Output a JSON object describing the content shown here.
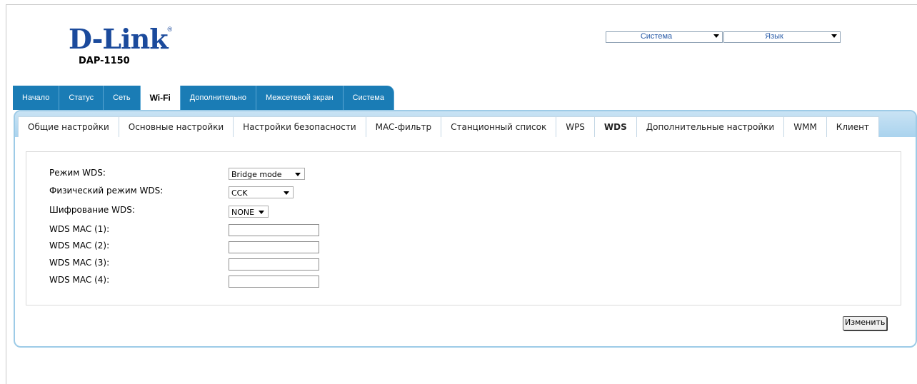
{
  "header": {
    "logo_text": "D-Link",
    "logo_reg": "®",
    "model": "DAP-1150",
    "system_select": "Система",
    "language_select": "Язык"
  },
  "main_tabs": [
    {
      "label": "Начало"
    },
    {
      "label": "Статус"
    },
    {
      "label": "Сеть"
    },
    {
      "label": "Wi-Fi",
      "active": true
    },
    {
      "label": "Дополнительно"
    },
    {
      "label": "Межсетевой экран"
    },
    {
      "label": "Система"
    }
  ],
  "sub_tabs": [
    {
      "label": "Общие настройки"
    },
    {
      "label": "Основные настройки"
    },
    {
      "label": "Настройки безопасности"
    },
    {
      "label": "MAC-фильтр"
    },
    {
      "label": "Станционный список"
    },
    {
      "label": "WPS"
    },
    {
      "label": "WDS",
      "active": true
    },
    {
      "label": "Дополнительные настройки"
    },
    {
      "label": "WMM"
    },
    {
      "label": "Клиент"
    }
  ],
  "form": {
    "wds_mode_label": "Режим WDS:",
    "wds_mode_value": "Bridge mode",
    "phy_mode_label": "Физический режим WDS:",
    "phy_mode_value": "CCK",
    "encryption_label": "Шифрование WDS:",
    "encryption_value": "NONE",
    "mac1_label": "WDS MAC (1):",
    "mac2_label": "WDS MAC (2):",
    "mac3_label": "WDS MAC (3):",
    "mac4_label": "WDS MAC (4):",
    "mac1_value": "",
    "mac2_value": "",
    "mac3_value": "",
    "mac4_value": ""
  },
  "apply_button": "Изменить",
  "colors": {
    "brand": "#1b4a9c",
    "tab_bg": "#1a7cb5",
    "panel_border": "#9dcbe7"
  }
}
